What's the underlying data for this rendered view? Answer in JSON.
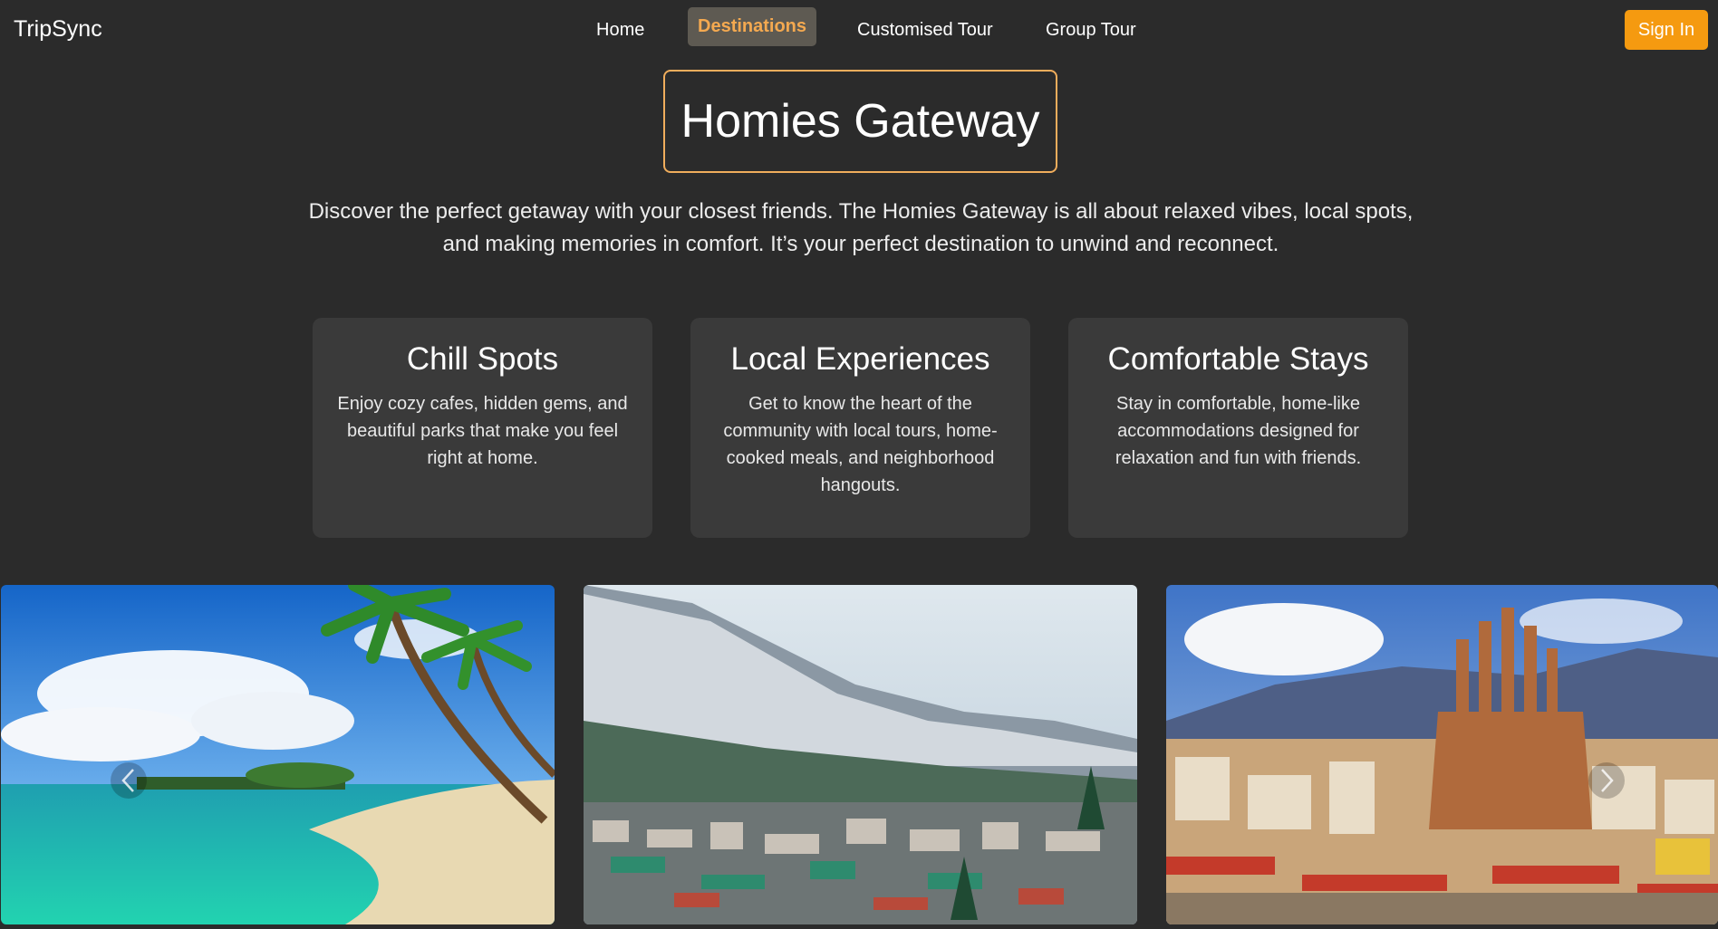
{
  "nav": {
    "brand": "TripSync",
    "links": [
      {
        "label": "Home"
      },
      {
        "label": "Destinations"
      },
      {
        "label": "Customised Tour"
      },
      {
        "label": "Group Tour"
      }
    ],
    "active_index": 1,
    "signin_label": "Sign In"
  },
  "hero": {
    "title": "Homies Gateway",
    "description": "Discover the perfect getaway with your closest friends. The Homies Gateway is all about relaxed vibes, local spots, and making memories in comfort. It’s your perfect destination to unwind and reconnect."
  },
  "features": [
    {
      "title": "Chill Spots",
      "text": "Enjoy cozy cafes, hidden gems, and beautiful parks that make you feel right at home."
    },
    {
      "title": "Local Experiences",
      "text": "Get to know the heart of the community with local tours, home-cooked meals, and neighborhood hangouts."
    },
    {
      "title": "Comfortable Stays",
      "text": "Stay in comfortable, home-like accommodations designed for relaxation and fun with friends."
    }
  ],
  "gallery": {
    "images": [
      {
        "subject": "tropical beach with palm trees"
      },
      {
        "subject": "snowy mountain town valley"
      },
      {
        "subject": "city skyline with cathedral"
      }
    ],
    "prev_icon": "chevron-left-icon",
    "next_icon": "chevron-right-icon"
  },
  "colors": {
    "background": "#2b2b2b",
    "card": "#3a3a3a",
    "accent": "#f59a10",
    "active_nav_text": "#f4a950",
    "title_border": "#f0ad5c"
  }
}
